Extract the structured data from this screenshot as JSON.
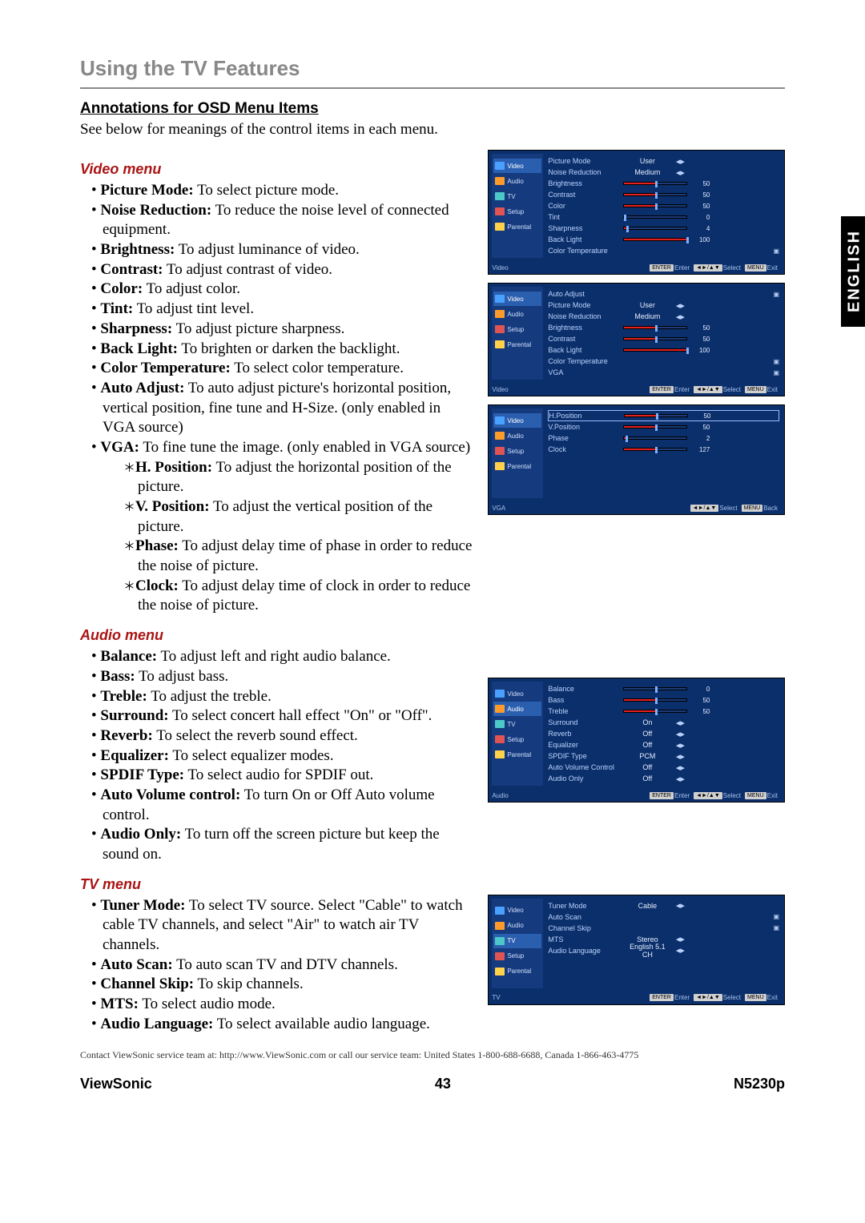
{
  "page_title": "Using the TV Features",
  "section_heading": "Annotations for OSD Menu Items",
  "intro": "See below for meanings of the control items in each menu.",
  "tabs": {
    "english": "ENGLISH"
  },
  "video": {
    "heading": "Video menu",
    "items": [
      {
        "term": "Picture Mode:",
        "desc": " To select picture mode."
      },
      {
        "term": "Noise Reduction:",
        "desc": " To reduce the noise level of connected equipment."
      },
      {
        "term": "Brightness:",
        "desc": " To adjust luminance of video."
      },
      {
        "term": "Contrast:",
        "desc": " To adjust contrast of video."
      },
      {
        "term": "Color:",
        "desc": " To adjust color."
      },
      {
        "term": "Tint:",
        "desc": " To adjust tint level."
      },
      {
        "term": "Sharpness:",
        "desc": " To adjust picture sharpness."
      },
      {
        "term": "Back Light:",
        "desc": " To brighten or darken the backlight."
      },
      {
        "term": "Color Temperature:",
        "desc": " To select color temperature."
      },
      {
        "term": "Auto Adjust:",
        "desc": " To auto adjust picture's horizontal position, vertical position, fine tune and H-Size. (only enabled in VGA source)"
      },
      {
        "term": "VGA:",
        "desc": " To fine tune the image. (only enabled in VGA source)"
      }
    ],
    "sub": [
      {
        "term": "H. Position:",
        "desc": " To adjust the horizontal position of the picture."
      },
      {
        "term": "V. Position:",
        "desc": " To adjust the vertical position of the picture."
      },
      {
        "term": "Phase:",
        "desc": " To adjust delay time of phase in order to reduce the noise of picture."
      },
      {
        "term": "Clock:",
        "desc": " To adjust delay time of clock in order to reduce the noise of picture."
      }
    ]
  },
  "audio": {
    "heading": "Audio menu",
    "items": [
      {
        "term": "Balance:",
        "desc": " To adjust left and right audio balance."
      },
      {
        "term": "Bass:",
        "desc": " To adjust bass."
      },
      {
        "term": "Treble:",
        "desc": " To adjust the treble."
      },
      {
        "term": "Surround:",
        "desc": " To select concert hall effect \"On\" or \"Off\"."
      },
      {
        "term": "Reverb:",
        "desc": " To select the reverb sound effect."
      },
      {
        "term": "Equalizer:",
        "desc": " To select equalizer modes."
      },
      {
        "term": "SPDIF Type:",
        "desc": " To select audio for SPDIF out."
      },
      {
        "term": "Auto Volume control:",
        "desc": " To turn On or Off Auto volume control."
      },
      {
        "term": "Audio Only:",
        "desc": " To turn off the screen picture but keep the sound on."
      }
    ]
  },
  "tv": {
    "heading": "TV menu",
    "items": [
      {
        "term": "Tuner Mode:",
        "desc": " To select TV source. Select \"Cable\" to watch cable TV channels, and select \"Air\" to watch air TV channels."
      },
      {
        "term": "Auto Scan:",
        "desc": " To auto scan TV and DTV channels."
      },
      {
        "term": "Channel Skip:",
        "desc": " To skip channels."
      },
      {
        "term": "MTS:",
        "desc": " To select audio mode."
      },
      {
        "term": "Audio Language:",
        "desc": " To select available audio language."
      }
    ]
  },
  "osd_nav": {
    "video": "Video",
    "audio": "Audio",
    "tv": "TV",
    "setup": "Setup",
    "parental": "Parental"
  },
  "osd_footer": {
    "enter": "ENTER",
    "enter_t": "Enter",
    "arrows": "◄►/▲▼",
    "select": "Select",
    "menu": "MENU",
    "exit": "Exit",
    "back": "Back"
  },
  "osd1": {
    "footer_name": "Video",
    "rows": [
      {
        "label": "Picture Mode",
        "val": "User",
        "arr": true
      },
      {
        "label": "Noise Reduction",
        "val": "Medium",
        "arr": true
      },
      {
        "label": "Brightness",
        "slider": 50,
        "num": "50"
      },
      {
        "label": "Contrast",
        "slider": 50,
        "num": "50"
      },
      {
        "label": "Color",
        "slider": 50,
        "num": "50"
      },
      {
        "label": "Tint",
        "slider": 0,
        "num": "0"
      },
      {
        "label": "Sharpness",
        "slider": 4,
        "num": "4"
      },
      {
        "label": "Back Light",
        "slider": 100,
        "num": "100"
      },
      {
        "label": "Color Temperature",
        "glyph": true
      }
    ]
  },
  "osd2": {
    "footer_name": "Video",
    "rows": [
      {
        "label": "Auto Adjust",
        "glyph": true
      },
      {
        "label": "Picture Mode",
        "val": "User",
        "arr": true
      },
      {
        "label": "Noise Reduction",
        "val": "Medium",
        "arr": true
      },
      {
        "label": "Brightness",
        "slider": 50,
        "num": "50"
      },
      {
        "label": "Contrast",
        "slider": 50,
        "num": "50"
      },
      {
        "label": "Back Light",
        "slider": 100,
        "num": "100"
      },
      {
        "label": "Color Temperature",
        "glyph": true
      },
      {
        "label": "VGA",
        "glyph": true
      }
    ]
  },
  "osd3": {
    "footer_name": "VGA",
    "rows": [
      {
        "label": "H.Position",
        "slider": 50,
        "num": "50",
        "hl": true
      },
      {
        "label": "V.Position",
        "slider": 50,
        "num": "50"
      },
      {
        "label": "Phase",
        "slider": 2,
        "num": "2"
      },
      {
        "label": "Clock",
        "slider": 50,
        "num": "127"
      }
    ]
  },
  "osd4": {
    "footer_name": "Audio",
    "rows": [
      {
        "label": "Balance",
        "slider": 50,
        "num": "0",
        "center": true
      },
      {
        "label": "Bass",
        "slider": 50,
        "num": "50"
      },
      {
        "label": "Treble",
        "slider": 50,
        "num": "50"
      },
      {
        "label": "Surround",
        "val": "On",
        "arr": true
      },
      {
        "label": "Reverb",
        "val": "Off",
        "arr": true
      },
      {
        "label": "Equalizer",
        "val": "Off",
        "arr": true
      },
      {
        "label": "SPDIF Type",
        "val": "PCM",
        "arr": true
      },
      {
        "label": "Auto Volume Control",
        "val": "Off",
        "arr": true
      },
      {
        "label": "Audio Only",
        "val": "Off",
        "arr": true
      }
    ]
  },
  "osd5": {
    "footer_name": "TV",
    "rows": [
      {
        "label": "Tuner Mode",
        "val": "Cable",
        "arr": true
      },
      {
        "label": "Auto Scan",
        "glyph": true
      },
      {
        "label": "Channel Skip",
        "glyph": true
      },
      {
        "label": "MTS",
        "val": "Stereo",
        "arr": true
      },
      {
        "label": "Audio Language",
        "val": "English 5.1 CH",
        "arr": true
      }
    ]
  },
  "contact": "Contact ViewSonic service team at: http://www.ViewSonic.com or call our service team: United States 1-800-688-6688, Canada 1-866-463-4775",
  "footer": {
    "brand": "ViewSonic",
    "page": "43",
    "model": "N5230p"
  }
}
